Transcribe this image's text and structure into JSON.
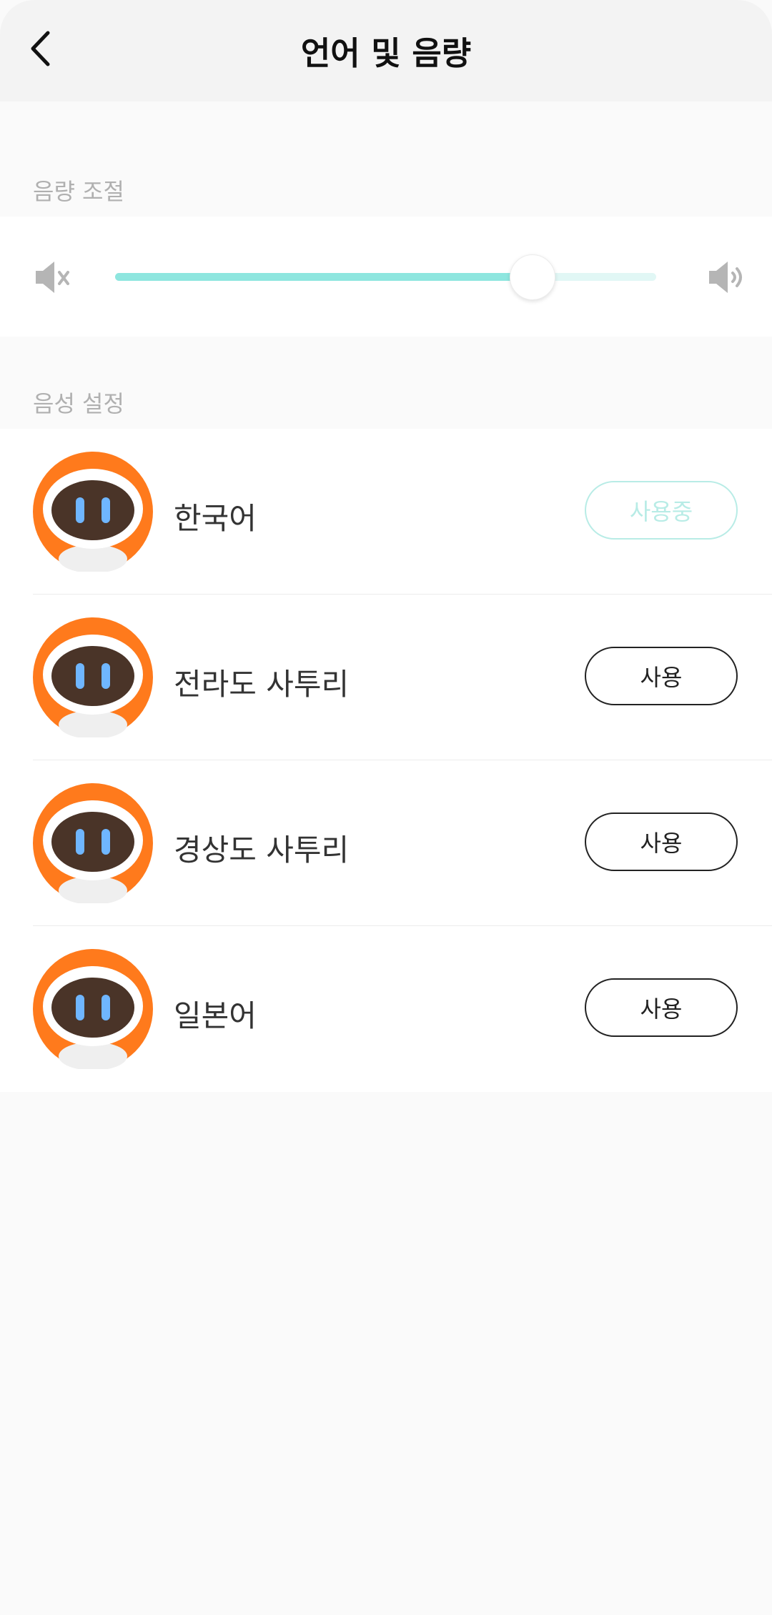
{
  "header": {
    "title": "언어 및 음량"
  },
  "volume": {
    "section_label": "음량 조절",
    "level_fraction": 0.77
  },
  "voice": {
    "section_label": "음성 설정",
    "items": [
      {
        "name": "한국어",
        "button": "사용중",
        "active": true
      },
      {
        "name": "전라도 사투리",
        "button": "사용",
        "active": false
      },
      {
        "name": "경상도 사투리",
        "button": "사용",
        "active": false
      },
      {
        "name": "일본어",
        "button": "사용",
        "active": false
      }
    ]
  },
  "colors": {
    "accent": "#8ee6df",
    "avatar_orange": "#ff7a1c",
    "active_button": "#b8ece6"
  },
  "icons": [
    "back-arrow-icon",
    "mute-icon",
    "volume-up-icon",
    "robot-avatar-icon"
  ]
}
